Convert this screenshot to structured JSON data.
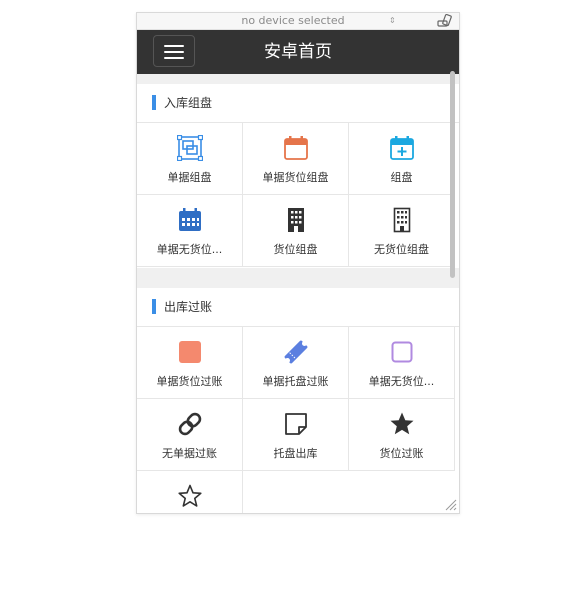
{
  "device_bar": {
    "selected": "no device selected"
  },
  "app": {
    "title": "安卓首页"
  },
  "sections": [
    {
      "title": "入库组盘",
      "items": [
        {
          "label": "单据组盘",
          "icon": "image-frame-icon",
          "color": "#3a8ee6"
        },
        {
          "label": "单据货位组盘",
          "icon": "calendar-icon",
          "color": "#e5744a"
        },
        {
          "label": "组盘",
          "icon": "calendar-plus-icon",
          "color": "#1ba8e0"
        },
        {
          "label": "单据无货位...",
          "icon": "calendar-grid-icon",
          "color": "#2f6ec4"
        },
        {
          "label": "货位组盘",
          "icon": "building-icon",
          "color": "#333333"
        },
        {
          "label": "无货位组盘",
          "icon": "building-outline-icon",
          "color": "#333333"
        }
      ]
    },
    {
      "title": "出库过账",
      "items": [
        {
          "label": "单据货位过账",
          "icon": "square-filled-icon",
          "color": "#f4896e"
        },
        {
          "label": "单据托盘过账",
          "icon": "ticket-icon",
          "color": "#5b7fe0"
        },
        {
          "label": "单据无货位...",
          "icon": "square-outline-icon",
          "color": "#b08ae0"
        },
        {
          "label": "无单据过账",
          "icon": "chain-link-icon",
          "color": "#333333"
        },
        {
          "label": "托盘出库",
          "icon": "sticky-note-icon",
          "color": "#333333"
        },
        {
          "label": "货位过账",
          "icon": "star-filled-icon",
          "color": "#333333"
        },
        {
          "label": "",
          "icon": "star-outline-icon",
          "color": "#333333"
        }
      ]
    }
  ]
}
